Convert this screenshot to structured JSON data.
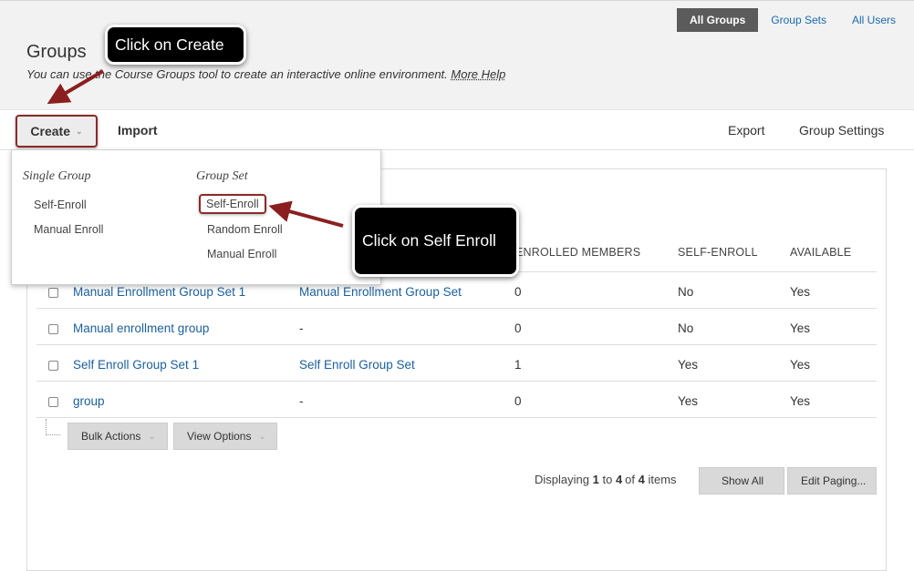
{
  "tabs": [
    {
      "label": "All Groups",
      "active": true
    },
    {
      "label": "Group Sets",
      "active": false
    },
    {
      "label": "All Users",
      "active": false
    }
  ],
  "header": {
    "title": "Groups",
    "subtitle": "You can use the Course Groups tool to create an interactive online environment.",
    "help_link": "More Help"
  },
  "action_bar": {
    "create": "Create",
    "import": "Import",
    "export": "Export",
    "settings": "Group Settings"
  },
  "dropdown": {
    "single_group_heading": "Single Group",
    "single_group_items": [
      "Self-Enroll",
      "Manual Enroll"
    ],
    "group_set_heading": "Group Set",
    "group_set_items": [
      "Self-Enroll",
      "Random Enroll",
      "Manual Enroll"
    ]
  },
  "table": {
    "headers": [
      "ENROLLED MEMBERS",
      "SELF-ENROLL",
      "AVAILABLE"
    ],
    "rows": [
      {
        "name": "Manual Enrollment Group Set 1",
        "group_set": "Manual Enrollment Group Set",
        "members": "0",
        "self_enroll": "No",
        "available": "Yes"
      },
      {
        "name": "Manual enrollment group",
        "group_set": "-",
        "members": "0",
        "self_enroll": "No",
        "available": "Yes"
      },
      {
        "name": "Self Enroll Group Set 1",
        "group_set": "Self Enroll Group Set",
        "members": "1",
        "self_enroll": "Yes",
        "available": "Yes"
      },
      {
        "name": "group",
        "group_set": "-",
        "members": "0",
        "self_enroll": "Yes",
        "available": "Yes"
      }
    ]
  },
  "bulk": {
    "bulk_actions": "Bulk Actions",
    "view_options": "View Options"
  },
  "paging": {
    "prefix": "Displaying",
    "from": "1",
    "to_word": "to",
    "to": "4",
    "of_word": "of",
    "total": "4",
    "suffix": "items",
    "show_all": "Show All",
    "edit_paging": "Edit Paging..."
  },
  "callouts": {
    "create": "Click on Create",
    "self_enroll": "Click on Self Enroll"
  },
  "colors": {
    "link": "#1b5f9e",
    "highlight_border": "#8b2a2a",
    "active_tab": "#5b5b5b"
  }
}
